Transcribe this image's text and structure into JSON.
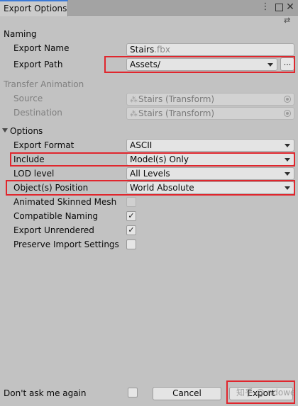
{
  "window": {
    "tab_title": "Export Options",
    "controls": [
      "kebab-menu-icon",
      "maximize-icon",
      "close-icon"
    ]
  },
  "naming": {
    "header": "Naming",
    "export_name_label": "Export Name",
    "export_name_value": "Stairs",
    "export_name_ext": ".fbx",
    "export_path_label": "Export Path",
    "export_path_value": "Assets/",
    "browse_label": "..."
  },
  "transfer": {
    "header": "Transfer Animation",
    "source_label": "Source",
    "source_value": "Stairs (Transform)",
    "destination_label": "Destination",
    "destination_value": "Stairs (Transform)"
  },
  "options": {
    "header": "Options",
    "export_format_label": "Export Format",
    "export_format_value": "ASCII",
    "include_label": "Include",
    "include_value": "Model(s) Only",
    "lod_label": "LOD level",
    "lod_value": "All Levels",
    "position_label": "Object(s) Position",
    "position_value": "World Absolute",
    "animated_skinned_label": "Animated Skinned Mesh",
    "animated_skinned_checked": false,
    "compatible_naming_label": "Compatible Naming",
    "compatible_naming_checked": true,
    "export_unrendered_label": "Export Unrendered",
    "export_unrendered_checked": true,
    "preserve_import_label": "Preserve Import Settings",
    "preserve_import_checked": false
  },
  "footer": {
    "dont_ask_label": "Don't ask me again",
    "dont_ask_checked": false,
    "cancel_label": "Cancel",
    "export_label": "Export",
    "watermark": "知乎 @ ndowe"
  },
  "colors": {
    "highlight": "#e0262d",
    "tab_accent": "#3b7ad8",
    "panel_bg": "#c2c2c2"
  }
}
